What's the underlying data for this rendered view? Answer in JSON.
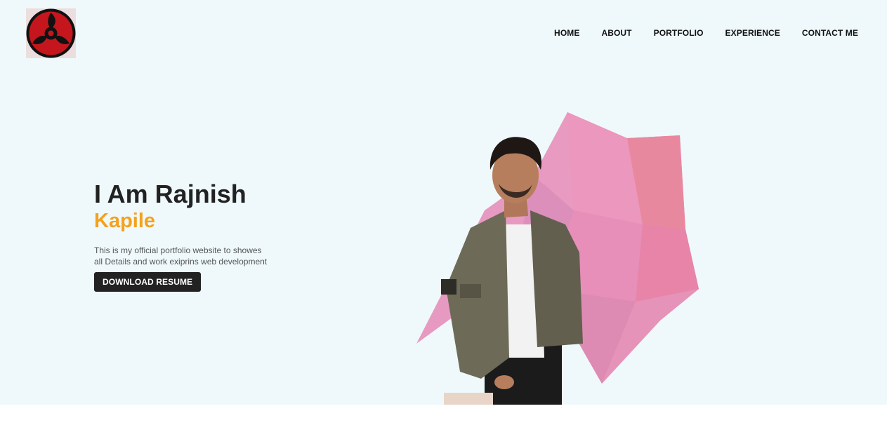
{
  "nav": {
    "items": [
      "HOME",
      "ABOUT",
      "PORTFOLIO",
      "EXPERIENCE",
      "CONTACT ME"
    ]
  },
  "hero": {
    "heading": "I Am Rajnish",
    "name": "Kapile",
    "description": "This is my official portfolio website to showes all Details and work exiprins web development",
    "cta_label": "DOWNLOAD RESUME"
  },
  "colors": {
    "background": "#eff9fb",
    "accent": "#f5a11c",
    "button": "#222222",
    "polygon": "#e88bb4"
  },
  "icons": {
    "logo": "sharingan-logo-icon"
  }
}
